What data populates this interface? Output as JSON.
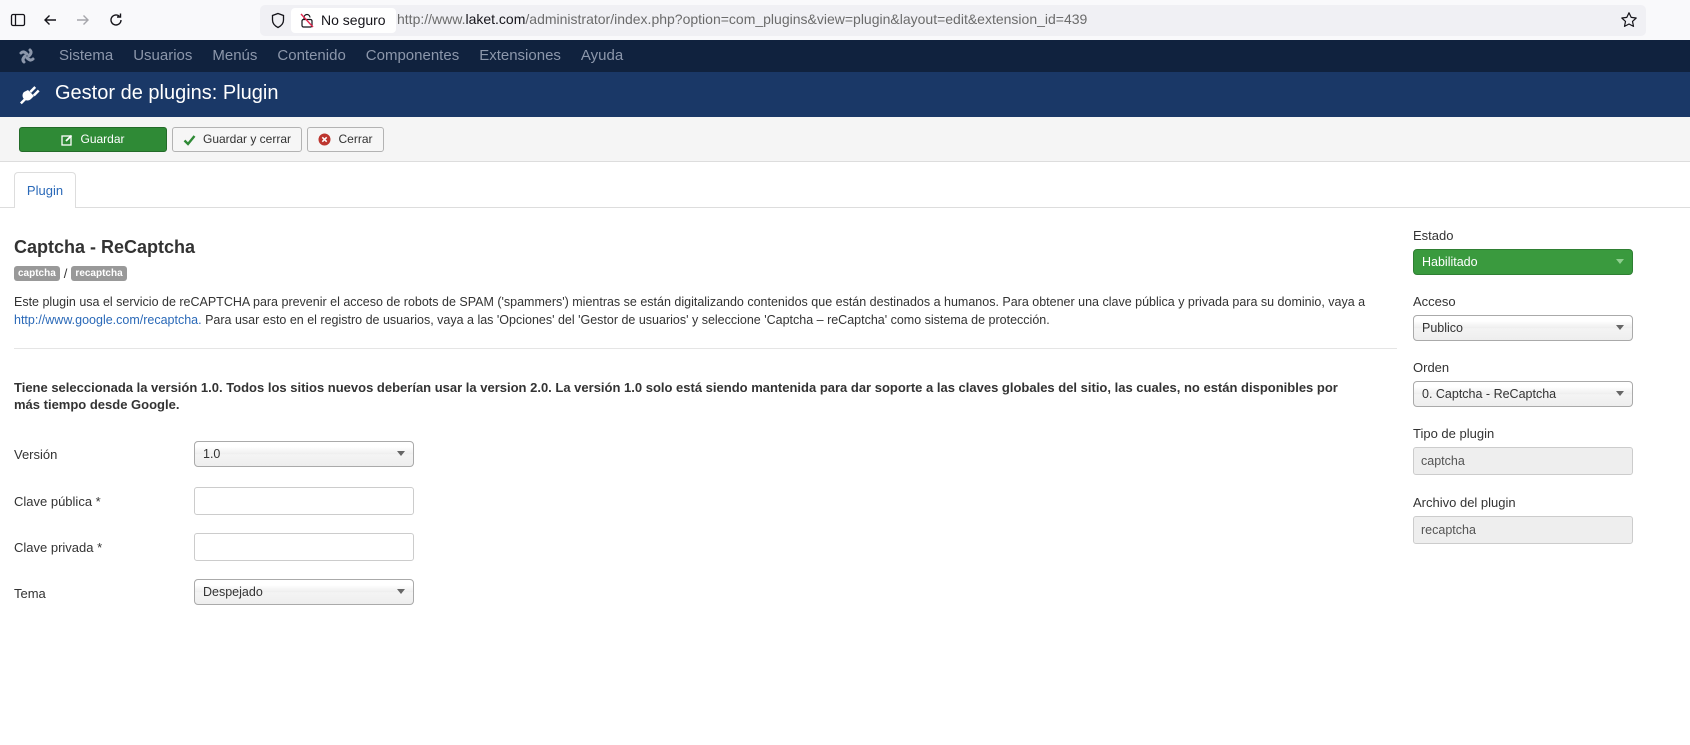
{
  "browser": {
    "security_label": "No seguro",
    "url_prefix": "http://www.",
    "url_domain": "laket.com",
    "url_path": "/administrator/index.php?option=com_plugins&view=plugin&layout=edit&extension_id=439"
  },
  "nav": {
    "items": [
      "Sistema",
      "Usuarios",
      "Menús",
      "Contenido",
      "Componentes",
      "Extensiones",
      "Ayuda"
    ]
  },
  "header": {
    "title": "Gestor de plugins: Plugin"
  },
  "toolbar": {
    "save_label": "Guardar",
    "save_close_label": "Guardar y cerrar",
    "close_label": "Cerrar"
  },
  "tabs": {
    "plugin": "Plugin"
  },
  "plugin": {
    "title": "Captcha - ReCaptcha",
    "badge_type": "captcha",
    "badge_separator": "/",
    "badge_element": "recaptcha",
    "desc_part1": "Este plugin usa el servicio de reCAPTCHA para prevenir el acceso de robots de SPAM ('spammers') mientras se están digitalizando contenidos que están destinados a humanos. Para obtener una clave pública y privada para su dominio, vaya a ",
    "desc_link": "http://www.google.com/recaptcha.",
    "desc_part2": " Para usar esto en el registro de usuarios, vaya a las 'Opciones' del 'Gestor de usuarios' y seleccione 'Captcha – reCaptcha' como sistema de protección.",
    "warning": "Tiene seleccionada la versión 1.0. Todos los sitios nuevos deberían usar la version 2.0. La versión 1.0 solo está siendo mantenida para dar soporte a las claves globales del sitio, las cuales, no están disponibles por más tiempo desde Google."
  },
  "form": {
    "version_label": "Versión",
    "version_value": "1.0",
    "public_key_label": "Clave pública *",
    "public_key_value": "",
    "private_key_label": "Clave privada *",
    "private_key_value": "",
    "theme_label": "Tema",
    "theme_value": "Despejado"
  },
  "sidebar": {
    "status_label": "Estado",
    "status_value": "Habilitado",
    "access_label": "Acceso",
    "access_value": "Publico",
    "order_label": "Orden",
    "order_value": "0. Captcha - ReCaptcha",
    "type_label": "Tipo de plugin",
    "type_value": "captcha",
    "file_label": "Archivo del plugin",
    "file_value": "recaptcha"
  },
  "colors": {
    "navbar": "#10223e",
    "header": "#1a3867",
    "save_button": "#2f8a36",
    "status_enabled": "#3a9a3e",
    "link": "#2a69b8"
  }
}
